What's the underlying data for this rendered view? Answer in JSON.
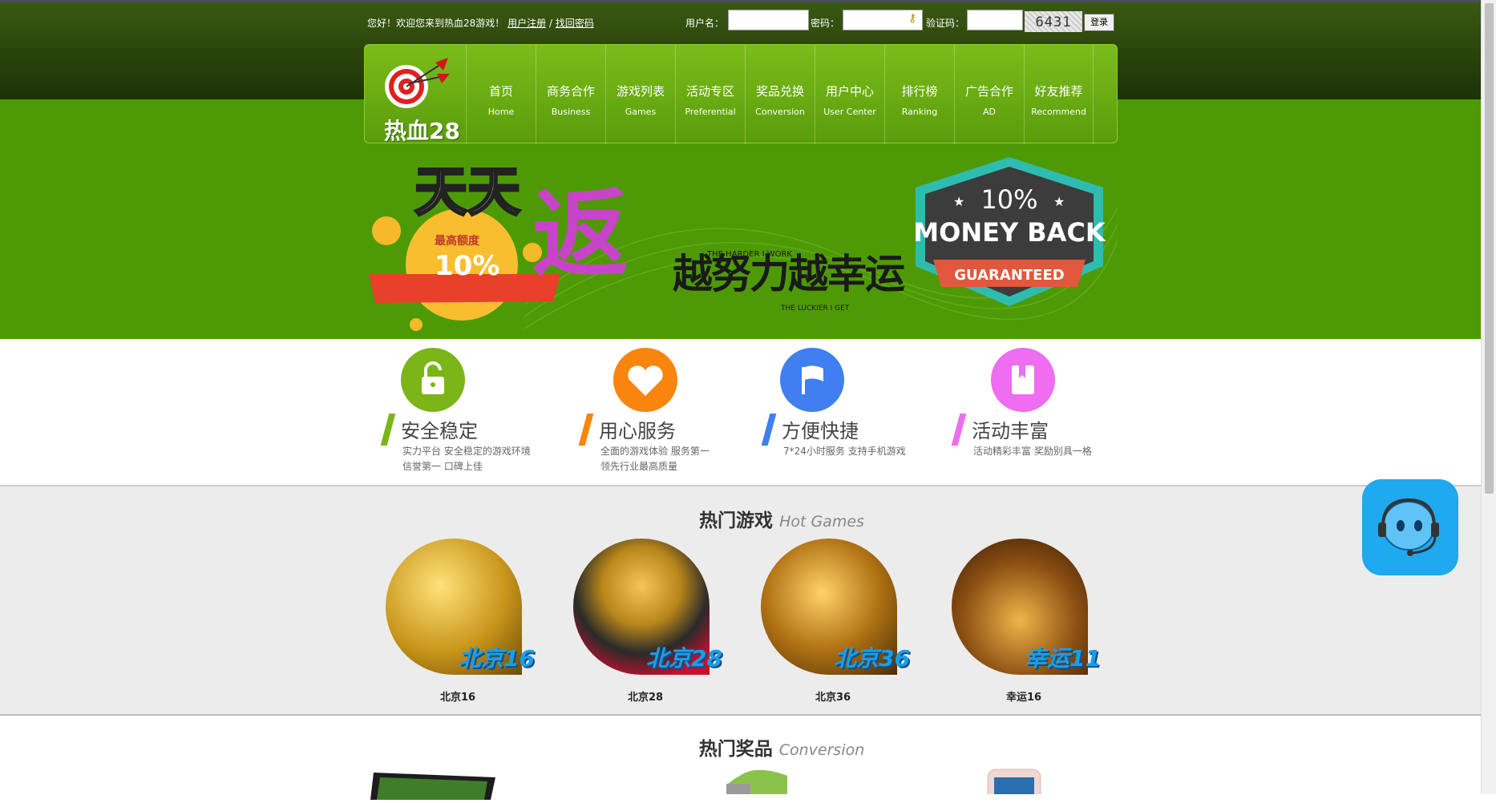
{
  "header": {
    "welcome": "您好！欢迎您来到热血28游戏！",
    "register_link": "用户注册",
    "separator": "/",
    "recover_link": "找回密码",
    "username_label": "用户名：",
    "password_label": "密码：",
    "captcha_label": "验证码：",
    "captcha_value": "6431",
    "login_button": "登录"
  },
  "logo": {
    "text": "热血28"
  },
  "nav": [
    {
      "zh": "首页",
      "en": "Home"
    },
    {
      "zh": "商务合作",
      "en": "Business"
    },
    {
      "zh": "游戏列表",
      "en": "Games"
    },
    {
      "zh": "活动专区",
      "en": "Preferential"
    },
    {
      "zh": "奖品兑换",
      "en": "Conversion"
    },
    {
      "zh": "用户中心",
      "en": "User Center"
    },
    {
      "zh": "排行榜",
      "en": "Ranking"
    },
    {
      "zh": "广告合作",
      "en": "AD"
    },
    {
      "zh": "好友推荐",
      "en": "Recommend"
    }
  ],
  "banner": {
    "headline": "天天",
    "big_char": "返",
    "coin_label": "最高额度",
    "coin_value": "10%",
    "slogan_1": "越努力越幸运",
    "slogan_en_1": "THE HARDER I WORK",
    "slogan_en_2": "THE LUCKIER I GET",
    "badge_percent": "10%",
    "badge_main": "MONEY BACK",
    "badge_ribbon": "GUARANTEED"
  },
  "features": [
    {
      "title": "安全稳定",
      "desc1": "实力平台 安全稳定的游戏环境",
      "desc2": "信誉第一 口碑上佳",
      "color": "#7cb518",
      "icon": "lock-icon"
    },
    {
      "title": "用心服务",
      "desc1": "全面的游戏体验 服务第一",
      "desc2": "领先行业最高质量",
      "color": "#f7850e",
      "icon": "heart-icon"
    },
    {
      "title": "方便快捷",
      "desc1": "7*24小时服务 支持手机游戏",
      "desc2": "",
      "color": "#3f7fef",
      "icon": "flag-icon"
    },
    {
      "title": "活动丰富",
      "desc1": "活动精彩丰富 奖励别具一格",
      "desc2": "",
      "color": "#ee6df0",
      "icon": "book-icon"
    }
  ],
  "hot_games": {
    "title": "热门游戏",
    "subtitle": "Hot Games",
    "items": [
      {
        "tag": "北京16",
        "name": "北京16"
      },
      {
        "tag": "北京28",
        "name": "北京28"
      },
      {
        "tag": "北京36",
        "name": "北京36"
      },
      {
        "tag": "幸运11",
        "name": "幸运16"
      }
    ]
  },
  "hot_prizes": {
    "title": "热门奖品",
    "subtitle": "Conversion"
  }
}
